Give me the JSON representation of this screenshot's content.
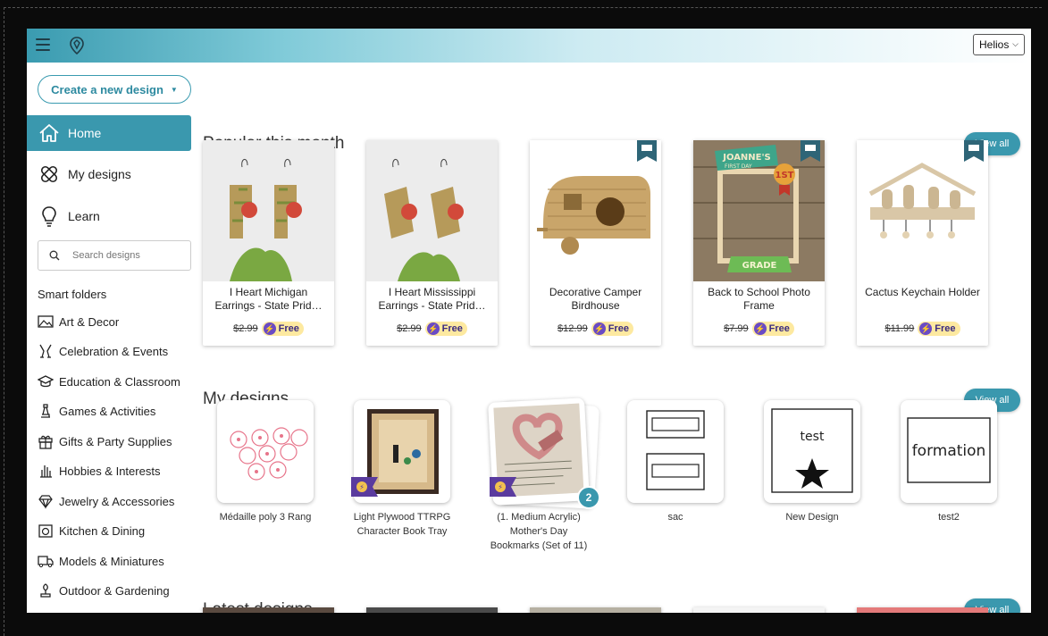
{
  "header": {
    "user": "Helios"
  },
  "sidebar": {
    "create_label": "Create a new design",
    "nav": [
      {
        "label": "Home",
        "icon": "home-icon"
      },
      {
        "label": "My designs",
        "icon": "my-designs-icon"
      },
      {
        "label": "Learn",
        "icon": "lightbulb-icon"
      }
    ],
    "search_placeholder": "Search designs",
    "smart_folders_title": "Smart folders",
    "folders": [
      {
        "label": "Art & Decor",
        "icon": "picture-icon"
      },
      {
        "label": "Celebration & Events",
        "icon": "champagne-icon"
      },
      {
        "label": "Education & Classroom",
        "icon": "graduation-cap-icon"
      },
      {
        "label": "Games & Activities",
        "icon": "chess-piece-icon"
      },
      {
        "label": "Gifts & Party Supplies",
        "icon": "gift-icon"
      },
      {
        "label": "Hobbies & Interests",
        "icon": "hobby-hand-icon"
      },
      {
        "label": "Jewelry & Accessories",
        "icon": "diamond-icon"
      },
      {
        "label": "Kitchen & Dining",
        "icon": "kitchen-icon"
      },
      {
        "label": "Models & Miniatures",
        "icon": "truck-icon"
      },
      {
        "label": "Outdoor & Gardening",
        "icon": "plant-icon"
      }
    ]
  },
  "popular": {
    "title": "Popular this month",
    "view_all": "View all",
    "items": [
      {
        "name": "I Heart Michigan Earrings - State Prid…",
        "price": "$2.99",
        "badge": "Free"
      },
      {
        "name": "I Heart Mississippi Earrings - State Prid…",
        "price": "$2.99",
        "badge": "Free"
      },
      {
        "name": "Decorative Camper Birdhouse",
        "price": "$12.99",
        "badge": "Free"
      },
      {
        "name": "Back to School Photo Frame",
        "price": "$7.99",
        "badge": "Free"
      },
      {
        "name": "Cactus Keychain Holder",
        "price": "$11.99",
        "badge": "Free"
      }
    ],
    "frame_text": {
      "name": "JOANNE'S",
      "day": "FIRST DAY",
      "rank": "1ST",
      "grade": "GRADE"
    }
  },
  "my_designs": {
    "title": "My designs",
    "view_all": "View all",
    "items": [
      {
        "name": "Médaille poly 3 Rang"
      },
      {
        "name": "Light Plywood TTRPG Character Book Tray"
      },
      {
        "name": "(1. Medium Acrylic) Mother's Day Bookmarks (Set of 11)",
        "count": "2"
      },
      {
        "name": "sac"
      },
      {
        "name": "New Design",
        "thumb_text": "test"
      },
      {
        "name": "test2",
        "thumb_text": "formation"
      }
    ]
  },
  "latest": {
    "title": "Latest designs",
    "view_all": "View all"
  }
}
